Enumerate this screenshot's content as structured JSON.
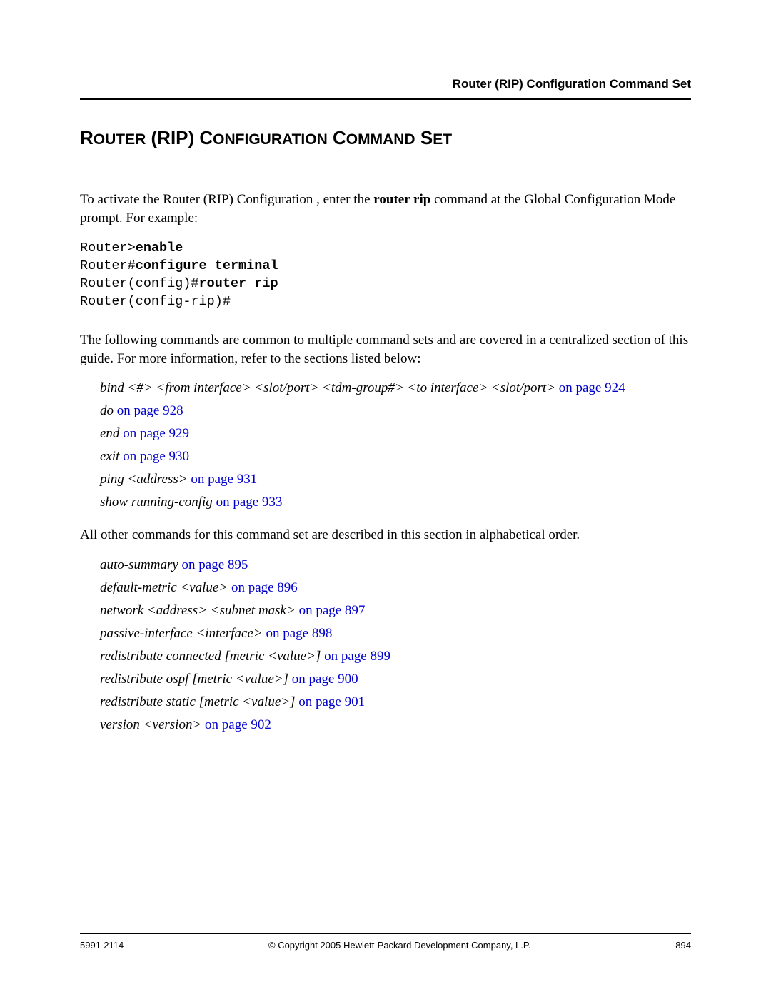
{
  "header": {
    "running": "Router (RIP) Configuration Command Set"
  },
  "title": {
    "w1": "R",
    "w1b": "OUTER",
    "w2": " (RIP) C",
    "w2b": "ONFIGURATION",
    "w3": " C",
    "w3b": "OMMAND",
    "w4": " S",
    "w4b": "ET"
  },
  "intro": {
    "p1a": "To activate the Router (RIP) Configuration , enter the ",
    "p1b": "router rip",
    "p1c": " command at the Global Configuration Mode prompt. For example:"
  },
  "code": {
    "l1a": "Router>",
    "l1b": "enable",
    "l2a": "Router#",
    "l2b": "configure terminal",
    "l3a": "Router(config)#",
    "l3b": "router rip",
    "l4": "Router(config-rip)#"
  },
  "para2": "The following commands are common to multiple command sets and are covered in a centralized section of this guide. For more information, refer to the sections listed below:",
  "common_refs": [
    {
      "cmd": "bind <#> <from interface> <slot/port> <tdm-group#> <to interface> <slot/port>",
      "link": " on page 924"
    },
    {
      "cmd": "do",
      "link": " on page 928"
    },
    {
      "cmd": "end",
      "link": " on page 929"
    },
    {
      "cmd": "exit",
      "link": " on page 930"
    },
    {
      "cmd": "ping <address>",
      "link": " on page 931"
    },
    {
      "cmd": "show running-config",
      "link": " on page 933"
    }
  ],
  "para3": "All other commands for this command set are described in this section in alphabetical order.",
  "cmd_refs": [
    {
      "cmd": "auto-summary",
      "link": " on page 895"
    },
    {
      "cmd": "default-metric <value>",
      "link": " on page 896"
    },
    {
      "cmd": "network <address> <subnet mask>",
      "link": " on page 897"
    },
    {
      "cmd": "passive-interface <interface>",
      "link": " on page 898"
    },
    {
      "cmd": "redistribute connected [metric <value>]",
      "link": " on page 899"
    },
    {
      "cmd": "redistribute ospf [metric <value>]",
      "link": " on page 900"
    },
    {
      "cmd": "redistribute static [metric <value>]",
      "link": " on page 901"
    },
    {
      "cmd": "version <version>",
      "link": " on page 902"
    }
  ],
  "footer": {
    "left": "5991-2114",
    "center": "© Copyright 2005 Hewlett-Packard Development Company, L.P.",
    "right": "894"
  }
}
